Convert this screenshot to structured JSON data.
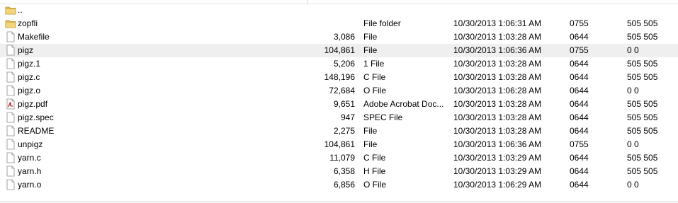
{
  "files": [
    {
      "icon": "folder-up-icon",
      "name": "..",
      "size": "",
      "type": "",
      "modified": "",
      "permissions": "",
      "owner": ""
    },
    {
      "icon": "folder-icon",
      "name": "zopfli",
      "size": "",
      "type": "File folder",
      "modified": "10/30/2013 1:06:31 AM",
      "permissions": "0755",
      "owner": "505 505"
    },
    {
      "icon": "file-icon",
      "name": "Makefile",
      "size": "3,086",
      "type": "File",
      "modified": "10/30/2013 1:03:28 AM",
      "permissions": "0644",
      "owner": "505 505"
    },
    {
      "icon": "file-icon",
      "name": "pigz",
      "size": "104,861",
      "type": "File",
      "modified": "10/30/2013 1:06:36 AM",
      "permissions": "0755",
      "owner": "0 0",
      "selected": true
    },
    {
      "icon": "file-icon",
      "name": "pigz.1",
      "size": "5,206",
      "type": "1 File",
      "modified": "10/30/2013 1:03:28 AM",
      "permissions": "0644",
      "owner": "505 505"
    },
    {
      "icon": "file-icon",
      "name": "pigz.c",
      "size": "148,196",
      "type": "C File",
      "modified": "10/30/2013 1:03:28 AM",
      "permissions": "0644",
      "owner": "505 505"
    },
    {
      "icon": "file-icon",
      "name": "pigz.o",
      "size": "72,684",
      "type": "O File",
      "modified": "10/30/2013 1:06:28 AM",
      "permissions": "0644",
      "owner": "0 0"
    },
    {
      "icon": "pdf-icon",
      "name": "pigz.pdf",
      "size": "9,651",
      "type": "Adobe Acrobat Doc...",
      "modified": "10/30/2013 1:03:28 AM",
      "permissions": "0644",
      "owner": "505 505"
    },
    {
      "icon": "file-icon",
      "name": "pigz.spec",
      "size": "947",
      "type": "SPEC File",
      "modified": "10/30/2013 1:03:28 AM",
      "permissions": "0644",
      "owner": "505 505"
    },
    {
      "icon": "file-icon",
      "name": "README",
      "size": "2,275",
      "type": "File",
      "modified": "10/30/2013 1:03:28 AM",
      "permissions": "0644",
      "owner": "505 505"
    },
    {
      "icon": "file-icon",
      "name": "unpigz",
      "size": "104,861",
      "type": "File",
      "modified": "10/30/2013 1:06:36 AM",
      "permissions": "0755",
      "owner": "0 0"
    },
    {
      "icon": "file-icon",
      "name": "yarn.c",
      "size": "11,079",
      "type": "C File",
      "modified": "10/30/2013 1:03:29 AM",
      "permissions": "0644",
      "owner": "505 505"
    },
    {
      "icon": "file-icon",
      "name": "yarn.h",
      "size": "6,358",
      "type": "H File",
      "modified": "10/30/2013 1:03:29 AM",
      "permissions": "0644",
      "owner": "505 505"
    },
    {
      "icon": "file-icon",
      "name": "yarn.o",
      "size": "6,856",
      "type": "O File",
      "modified": "10/30/2013 1:06:29 AM",
      "permissions": "0644",
      "owner": "0 0"
    }
  ],
  "colors": {
    "selected_row": "#efefef",
    "folder": "#e8c35a",
    "pdf": "#c8181b"
  }
}
